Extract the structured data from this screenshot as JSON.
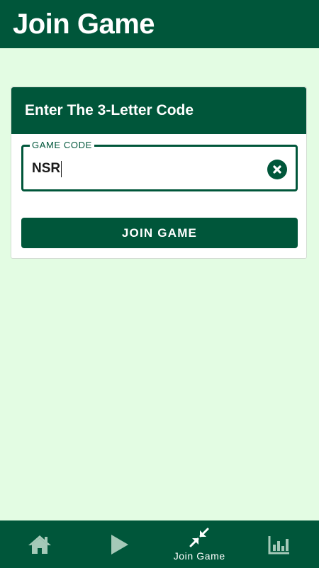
{
  "app_bar": {
    "title": "Join Game"
  },
  "card": {
    "title": "Enter The 3-Letter Code",
    "field": {
      "label": "GAME CODE",
      "value": "NSR",
      "clear_icon": "close-circle-icon"
    },
    "submit_label": "JOIN GAME"
  },
  "bottom_nav": {
    "items": [
      {
        "icon": "home-icon",
        "label": "",
        "active": false
      },
      {
        "icon": "play-icon",
        "label": "",
        "active": false
      },
      {
        "icon": "join-arrows-icon",
        "label": "Join Game",
        "active": true
      },
      {
        "icon": "bar-chart-icon",
        "label": "",
        "active": false
      }
    ]
  },
  "colors": {
    "primary": "#00563a",
    "background": "#e3fce3",
    "inactive_icon": "#a5c9b8"
  }
}
